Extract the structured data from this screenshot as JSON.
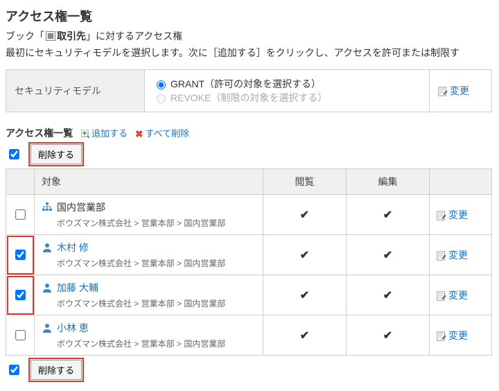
{
  "page": {
    "title": "アクセス権一覧",
    "book_prefix": "ブック「",
    "book_name": "取引先",
    "book_suffix": "」に対するアクセス権",
    "description": "最初にセキュリティモデルを選択します。次に［追加する］をクリックし、アクセスを許可または制限す"
  },
  "model": {
    "label": "セキュリティモデル",
    "grant": "GRANT（許可の対象を選択する）",
    "revoke": "REVOKE（制限の対象を選択する）",
    "change": "変更"
  },
  "list": {
    "heading": "アクセス権一覧",
    "add": "追加する",
    "delete_all": "すべて削除",
    "delete": "削除する",
    "columns": {
      "target": "対象",
      "view": "閲覧",
      "edit": "編集"
    },
    "change": "変更",
    "rows": [
      {
        "type": "org",
        "name": "国内営業部",
        "path": "ボウズマン株式会社 > 営業本部 > 国内営業部",
        "checked": false,
        "view": true,
        "edit": true,
        "hl": false
      },
      {
        "type": "user",
        "name": "木村 修",
        "path": "ボウズマン株式会社 > 営業本部 > 国内営業部",
        "checked": true,
        "view": true,
        "edit": true,
        "hl": true
      },
      {
        "type": "user",
        "name": "加藤 大輔",
        "path": "ボウズマン株式会社 > 営業本部 > 国内営業部",
        "checked": true,
        "view": true,
        "edit": true,
        "hl": true
      },
      {
        "type": "user",
        "name": "小林 恵",
        "path": "ボウズマン株式会社 > 営業本部 > 国内営業部",
        "checked": false,
        "view": true,
        "edit": true,
        "hl": false
      }
    ]
  }
}
